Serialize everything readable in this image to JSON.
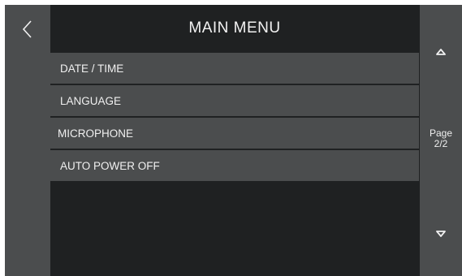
{
  "header": {
    "title": "MAIN MENU"
  },
  "nav": {
    "back_icon": "chevron-left-icon"
  },
  "menu": {
    "items": [
      {
        "label": "DATE / TIME"
      },
      {
        "label": "LANGUAGE"
      },
      {
        "label": "MICROPHONE"
      },
      {
        "label": "AUTO POWER OFF"
      }
    ]
  },
  "pager": {
    "label": "Page",
    "value": "2/2",
    "up_icon": "triangle-up-icon",
    "down_icon": "triangle-down-icon"
  },
  "colors": {
    "background": "#1f2122",
    "panel": "#4b4d4e",
    "text": "#f0f0f0"
  }
}
